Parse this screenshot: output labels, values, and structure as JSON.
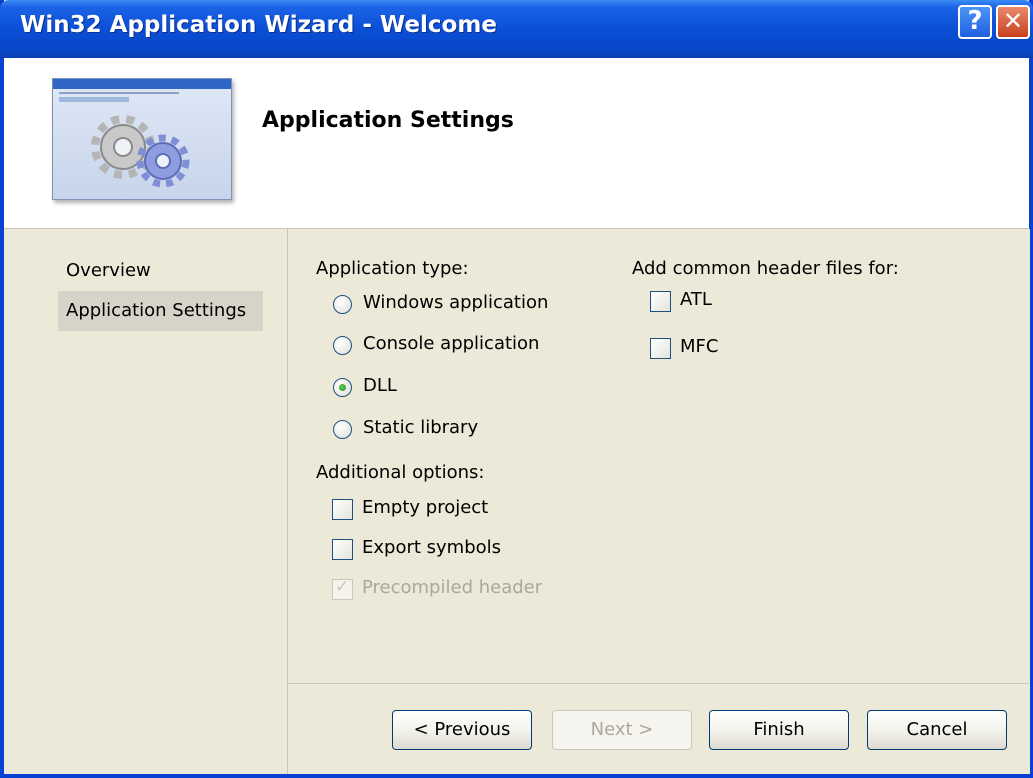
{
  "window": {
    "title": "Win32 Application Wizard - Welcome",
    "help_glyph": "?",
    "close_glyph": "✕"
  },
  "header": {
    "title": "Application Settings",
    "banner_icon": "gears-icon"
  },
  "nav": {
    "items": [
      {
        "label": "Overview",
        "active": false
      },
      {
        "label": "Application Settings",
        "active": true
      }
    ]
  },
  "app_type": {
    "label": "Application type:",
    "options": [
      {
        "label": "Windows application",
        "checked": false
      },
      {
        "label": "Console application",
        "checked": false
      },
      {
        "label": "DLL",
        "checked": true
      },
      {
        "label": "Static library",
        "checked": false
      }
    ]
  },
  "additional": {
    "label": "Additional options:",
    "options": [
      {
        "label": "Empty project",
        "checked": false,
        "enabled": true
      },
      {
        "label": "Export symbols",
        "checked": false,
        "enabled": true
      },
      {
        "label": "Precompiled header",
        "checked": true,
        "enabled": false
      }
    ]
  },
  "headers": {
    "label": "Add common header files for:",
    "options": [
      {
        "label": "ATL",
        "checked": false
      },
      {
        "label": "MFC",
        "checked": false
      }
    ]
  },
  "buttons": {
    "previous": "< Previous",
    "next": "Next >",
    "finish": "Finish",
    "cancel": "Cancel"
  },
  "colors": {
    "titlebar": "#0a4fd6",
    "window_bg": "#ece9d8",
    "header_bg": "#ffffff"
  }
}
